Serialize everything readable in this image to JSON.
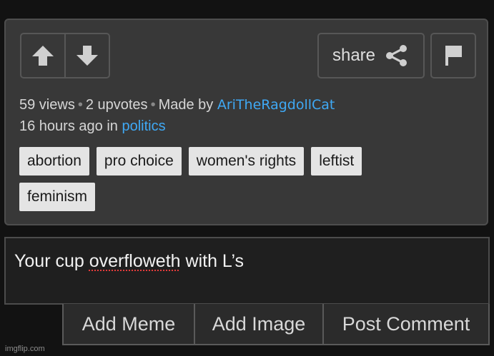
{
  "post": {
    "views": "59 views",
    "upvotes": "2 upvotes",
    "made_by_prefix": "Made by",
    "author": "AriTheRagdollCat",
    "time_prefix": "16 hours ago in",
    "stream": "politics",
    "share_label": "share",
    "upvote_icon": "arrow-up-icon",
    "downvote_icon": "arrow-down-icon",
    "share_icon": "share-icon",
    "flag_icon": "flag-icon",
    "link_color": "#3fa9f5"
  },
  "tags": [
    "abortion",
    "pro choice",
    "women's rights",
    "leftist",
    "feminism"
  ],
  "comment": {
    "text_before": "Your cup ",
    "misspelled_word": "overfloweth",
    "text_after": " with L’s"
  },
  "actions": {
    "add_meme": "Add Meme",
    "add_image": "Add Image",
    "post_comment": "Post Comment"
  },
  "watermark": "imgflip.com"
}
